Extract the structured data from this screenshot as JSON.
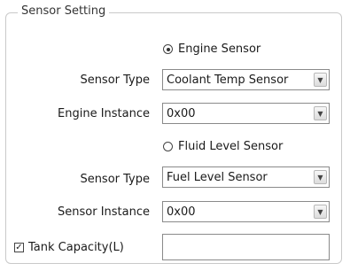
{
  "group": {
    "title": "Sensor Setting"
  },
  "engine_sensor": {
    "radio_label": "Engine Sensor",
    "radio_checked": true,
    "type_label": "Sensor Type",
    "type_value": "Coolant Temp Sensor",
    "instance_label": "Engine Instance",
    "instance_value": "0x00"
  },
  "fluid_sensor": {
    "radio_label": "Fluid Level Sensor",
    "radio_checked": false,
    "type_label": "Sensor Type",
    "type_value": "Fuel Level Sensor",
    "instance_label": "Sensor Instance",
    "instance_value": "0x00"
  },
  "tank_capacity": {
    "label": "Tank Capacity(L)",
    "checked": true,
    "value": ""
  },
  "icons": {
    "dropdown": "chevron-down-icon",
    "check": "check-icon"
  }
}
